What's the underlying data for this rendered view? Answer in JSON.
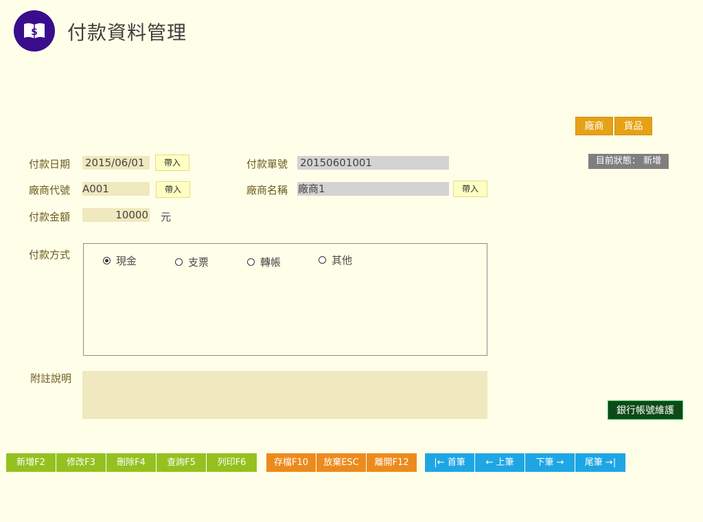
{
  "header": {
    "title": "付款資料管理"
  },
  "top_buttons": {
    "vendor": "廠商",
    "goods": "貨品"
  },
  "status": {
    "label": "目前狀態：",
    "value": "新增"
  },
  "form": {
    "pay_date": {
      "label": "付款日期",
      "value": "2015/06/01",
      "import": "帶入"
    },
    "pay_no": {
      "label": "付款單號",
      "value": "20150601001"
    },
    "vendor_code": {
      "label": "廠商代號",
      "value": "A001",
      "import": "帶入"
    },
    "vendor_name": {
      "label": "廠商名稱",
      "value": "廠商1",
      "import": "帶入"
    },
    "amount": {
      "label": "付款金額",
      "value": "10000",
      "unit": "元"
    },
    "pay_method": {
      "label": "付款方式",
      "options": [
        {
          "label": "現金",
          "selected": true
        },
        {
          "label": "支票",
          "selected": false
        },
        {
          "label": "轉帳",
          "selected": false
        },
        {
          "label": "其他",
          "selected": false
        }
      ]
    },
    "remarks": {
      "label": "附註說明",
      "value": ""
    }
  },
  "bank_button": "銀行帳號維護",
  "toolbar": {
    "green": [
      "新增F2",
      "修改F3",
      "刪除F4",
      "查詢F5",
      "列印F6"
    ],
    "orange": [
      "存檔F10",
      "放棄ESC",
      "離開F12"
    ],
    "blue": [
      "|← 首筆",
      "← 上筆",
      "下筆 →",
      "尾筆 →|"
    ]
  },
  "colors": {
    "background": "#ffffe9",
    "logo": "#3a0d8c",
    "input_bg": "#f0e8be",
    "readonly_bg": "#d3d3d3",
    "green": "#94c11f",
    "orange": "#ec8b1d",
    "blue": "#1ea6e4",
    "gold": "#e6a117",
    "bank_button": "#0d4a17"
  }
}
